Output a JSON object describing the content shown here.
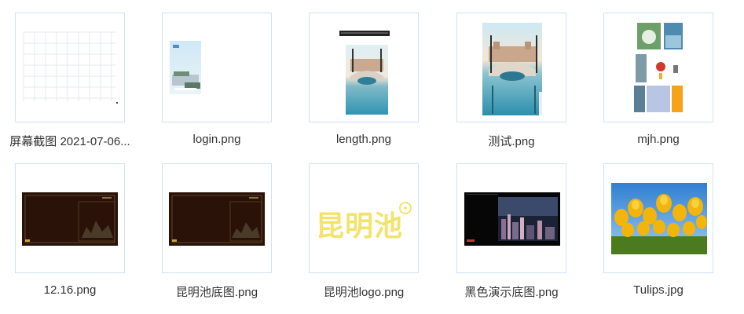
{
  "files": [
    {
      "name": "屏幕截图 2021-07-06...",
      "thumb": "grid-screenshot-thumbnail"
    },
    {
      "name": "login.png",
      "thumb": "login-thumbnail"
    },
    {
      "name": "length.png",
      "thumb": "plaza-bridge-thumbnail"
    },
    {
      "name": "测试.png",
      "thumb": "plaza-bridge-thumbnail"
    },
    {
      "name": "mjh.png",
      "thumb": "collage-thumbnail"
    },
    {
      "name": "12.16.png",
      "thumb": "dark-frame-thumbnail"
    },
    {
      "name": "昆明池底图.png",
      "thumb": "dark-frame-thumbnail"
    },
    {
      "name": "昆明池logo.png",
      "thumb": "yellow-logo-thumbnail"
    },
    {
      "name": "黑色演示底图.png",
      "thumb": "dark-city-thumbnail"
    },
    {
      "name": "Tulips.jpg",
      "thumb": "tulips-thumbnail"
    }
  ],
  "logo_text": "昆明池",
  "colors": {
    "border": "#cfe3f4",
    "text": "#333333",
    "logo": "#f2e36b",
    "dark": "#2a1208"
  }
}
